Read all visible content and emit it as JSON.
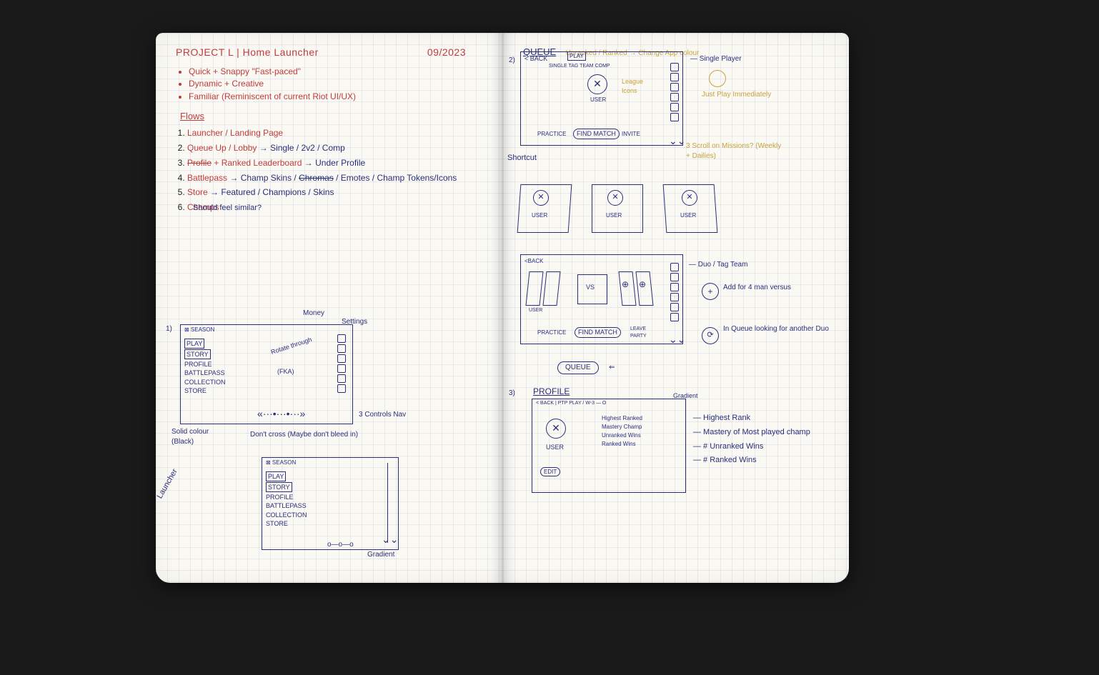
{
  "header": {
    "title": "PROJECT L | Home Launcher",
    "date": "09/2023"
  },
  "goals": [
    "Quick + Snappy \"Fast-paced\"",
    "Dynamic + Creative",
    "Familiar (Reminiscent of current Riot UI/UX)"
  ],
  "flows_heading": "Flows",
  "flows": [
    {
      "num": "1.",
      "label": "Launcher / Landing Page",
      "arrow": ""
    },
    {
      "num": "2.",
      "label": "Queue Up / Lobby",
      "arrow": "→ Single / 2v2 / Comp"
    },
    {
      "num": "3.",
      "label_strike": "Profile",
      "label2_strike": "Ranked",
      "plus": " + Ranked Leaderboard",
      "arrow": "→ Under Profile"
    },
    {
      "num": "4.",
      "label": "Battlepass",
      "arrow": "→ Champ Skins / ",
      "arrow_strike": "Chromas",
      "arrow2": " / Emotes / Champ Tokens/Icons"
    },
    {
      "num": "5.",
      "label": "Store",
      "arrow": "→ Featured / Champions / Skins"
    },
    {
      "num": "6.",
      "label": "Champs",
      "note": "Should feel similar?"
    }
  ],
  "wf1": {
    "tag": "1)",
    "season": "⊠ SEASON",
    "menu": [
      "PLAY",
      "STORY",
      "PROFILE",
      "BATTLEPASS",
      "COLLECTION",
      "STORE"
    ],
    "money": "Money",
    "settings": "Settings",
    "rotate": "Rotate through",
    "fka": "(FKA)",
    "controls": "3 Controls Nav",
    "dontcross": "Don't cross (Maybe don't bleed in)",
    "solid": "Solid colour (Black)",
    "launcher": "Launcher",
    "gradient": "Gradient"
  },
  "queue": {
    "heading": "QUEUE",
    "subhead": "Unranked / Ranked → Change App colour",
    "tag": "2)",
    "back": "< BACK",
    "tabs": "SINGLE  TAG TEAM  COMP",
    "top_play": "PLAY",
    "user": "USER",
    "league_icons": "League Icons",
    "just_play": "Just Play Immediately",
    "buttons": {
      "practice": "PRACTICE",
      "find": "FIND MATCH",
      "invite": "INVITE"
    },
    "shortcut": "Shortcut",
    "missions": "3 Scroll on Missions? (Weekly + Dailies)",
    "single": "— Single Player"
  },
  "user_cards": [
    "USER",
    "USER",
    "USER"
  ],
  "duo": {
    "back": "<BACK",
    "vs": "VS",
    "user": "USER",
    "practice": "PRACTICE",
    "find": "FIND MATCH",
    "leave": "LEAVE PARTY",
    "queue_btn": "QUEUE",
    "label": "— Duo / Tag Team",
    "add": "Add for 4 man versus",
    "inqueue": "In Queue looking for another Duo"
  },
  "profile": {
    "tag": "3)",
    "heading": "PROFILE",
    "breadcrumb": "< BACK | PTP  PLAY / W-3 — O",
    "gradient": "Gradient",
    "user": "USER",
    "edit": "EDIT",
    "stats": [
      "Highest Ranked",
      "Mastery Champ",
      "Unranked Wins",
      "Ranked Wins"
    ],
    "notes": [
      "— Highest Rank",
      "— Mastery of Most played champ",
      "— # Unranked Wins",
      "— # Ranked Wins"
    ]
  }
}
